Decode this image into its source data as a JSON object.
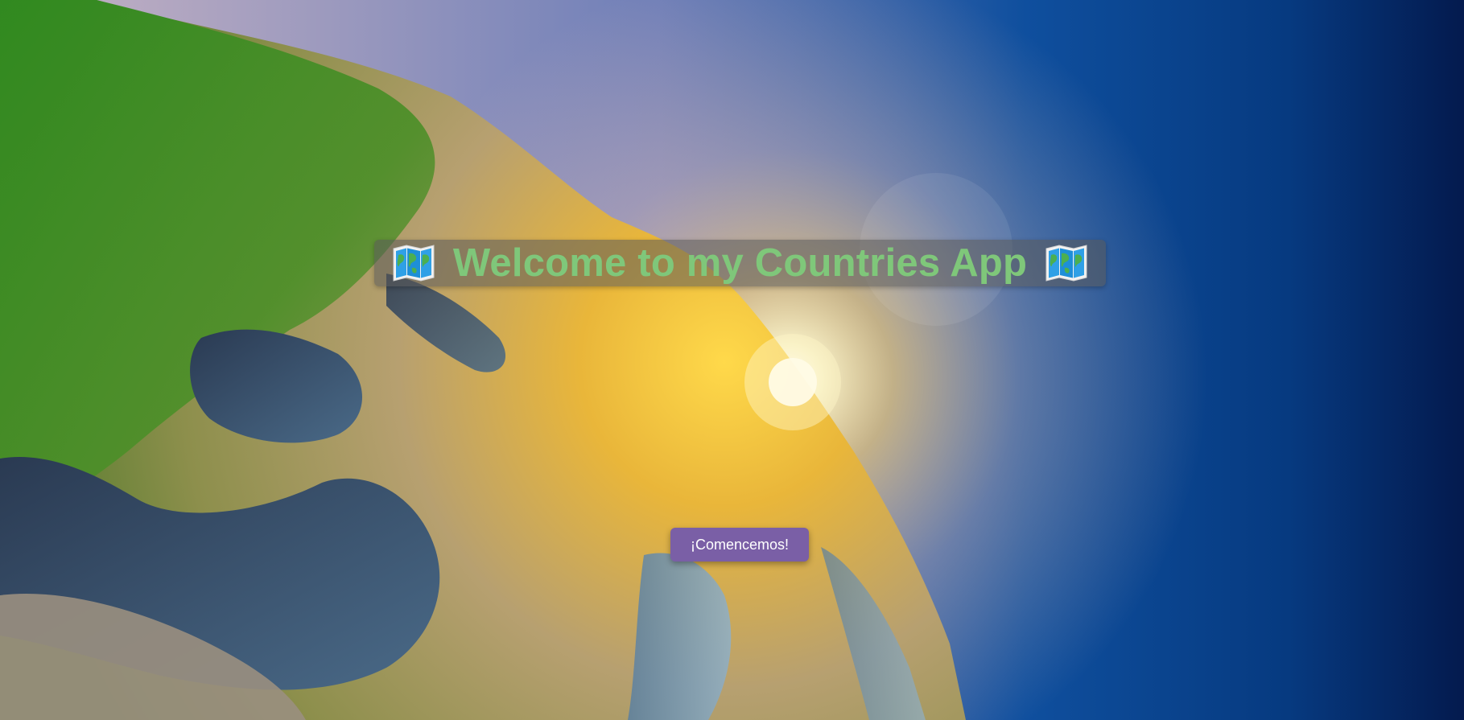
{
  "header": {
    "title": "Welcome to my Countries App",
    "left_icon": "world-map-icon",
    "right_icon": "world-map-icon"
  },
  "main": {
    "start_button_label": "¡Comencemos!"
  },
  "colors": {
    "title_text": "#7fc77a",
    "title_banner_bg": "rgba(90,90,90,0.55)",
    "button_bg": "#7a5fa6",
    "button_text": "#ffffff",
    "space_dark": "#04164a"
  },
  "background": {
    "description_icon": "earth-from-space-sunrise-image"
  }
}
